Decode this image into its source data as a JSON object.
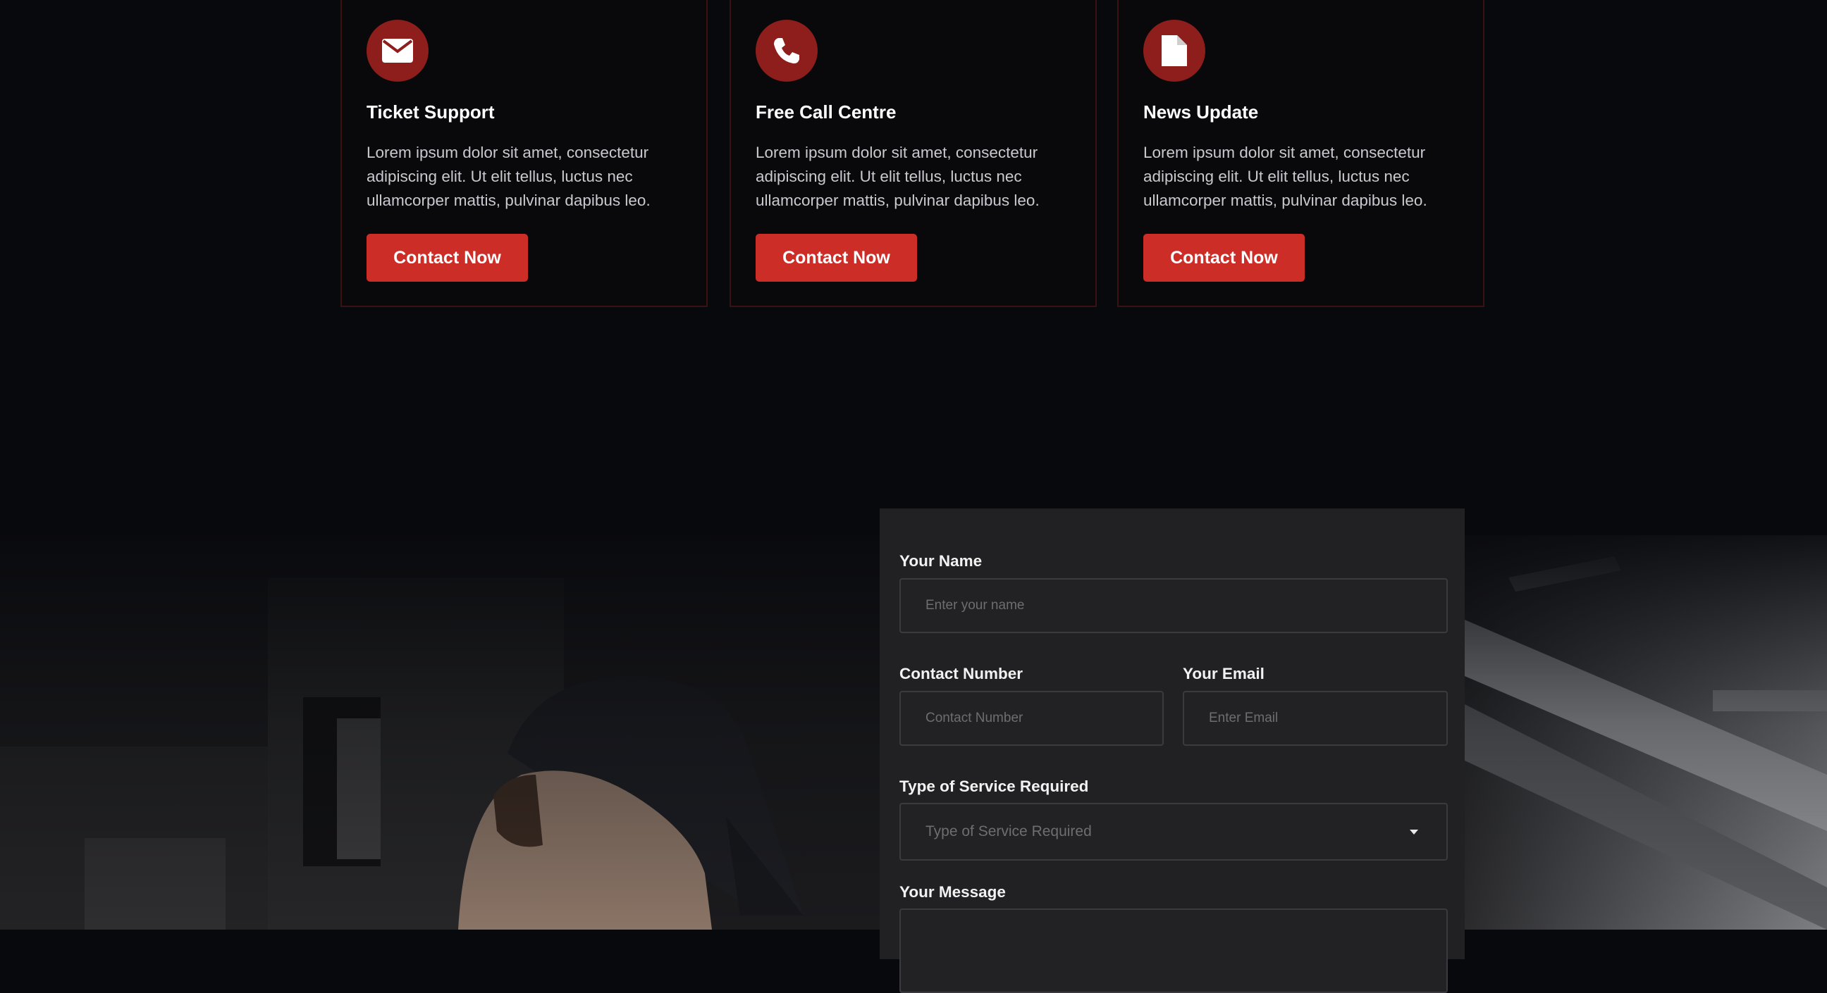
{
  "colors": {
    "background": "#08090c",
    "accent": "#cc2e27",
    "icon_circle": "#8d1e1b",
    "card_border": "#3a1212",
    "form_panel": "#222225"
  },
  "cards": [
    {
      "icon": "envelope-icon",
      "title": "Ticket Support",
      "text": "Lorem ipsum dolor sit amet, consectetur adipiscing elit. Ut elit tellus, luctus nec ullamcorper mattis, pulvinar dapibus leo.",
      "button_label": "Contact Now"
    },
    {
      "icon": "phone-icon",
      "title": "Free Call Centre",
      "text": "Lorem ipsum dolor sit amet, consectetur adipiscing elit. Ut elit tellus, luctus nec ullamcorper mattis, pulvinar dapibus leo.",
      "button_label": "Contact Now"
    },
    {
      "icon": "document-icon",
      "title": "News Update",
      "text": "Lorem ipsum dolor sit amet, consectetur adipiscing elit. Ut elit tellus, luctus nec ullamcorper mattis, pulvinar dapibus leo.",
      "button_label": "Contact Now"
    }
  ],
  "form": {
    "name_label": "Your Name",
    "name_placeholder": "Enter your name",
    "number_label": "Contact Number",
    "number_placeholder": "Contact Number",
    "email_label": "Your Email",
    "email_placeholder": "Enter Email",
    "service_label": "Type of Service Required",
    "service_placeholder": "Type of Service Required",
    "message_label": "Your Message"
  }
}
